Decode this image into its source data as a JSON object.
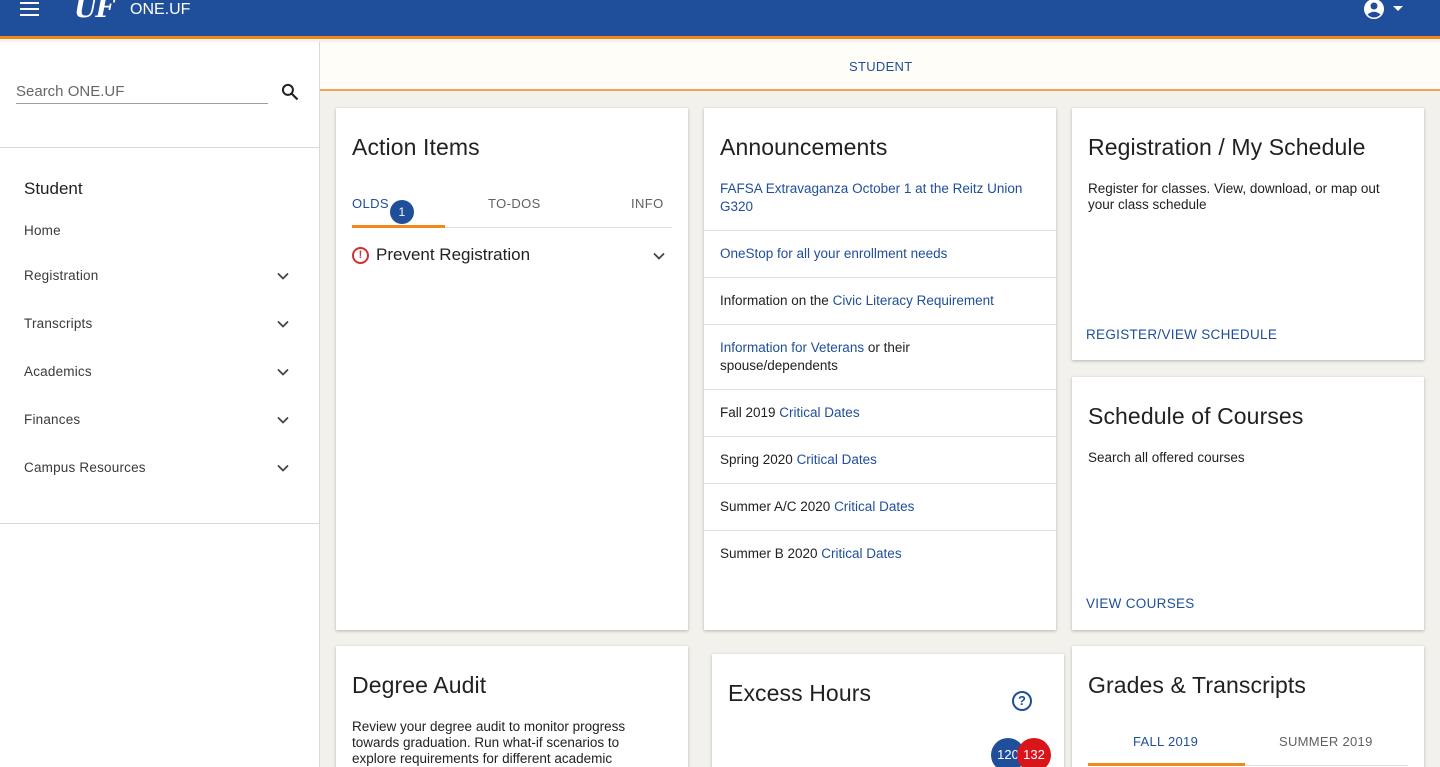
{
  "header": {
    "logo": "UF",
    "title": "ONE.UF"
  },
  "sidebar": {
    "search": {
      "placeholder": "Search ONE.UF",
      "value": ""
    },
    "heading": "Student",
    "items": [
      {
        "label": "Home"
      },
      {
        "label": "Registration"
      },
      {
        "label": "Transcripts"
      },
      {
        "label": "Academics"
      },
      {
        "label": "Finances"
      },
      {
        "label": "Campus Resources"
      }
    ]
  },
  "tabstrip": {
    "active": "STUDENT"
  },
  "action_items": {
    "title": "Action Items",
    "tabs": {
      "holds": "OLDS",
      "holds_count": "1",
      "todos": "TO-DOS",
      "info": "INFO"
    },
    "hold": {
      "label": "Prevent Registration"
    }
  },
  "announcements": {
    "title": "Announcements",
    "items": [
      {
        "prefix": "",
        "link": "FAFSA Extravaganza October 1 at the Reitz Union G320",
        "suffix": ""
      },
      {
        "prefix": "",
        "link": "OneStop for all your enrollment needs",
        "suffix": ""
      },
      {
        "prefix": "Information on the ",
        "link": "Civic Literacy Requirement",
        "suffix": ""
      },
      {
        "prefix": "",
        "link": "Information for Veterans",
        "suffix": " or their spouse/dependents"
      },
      {
        "prefix": "Fall 2019 ",
        "link": "Critical Dates",
        "suffix": ""
      },
      {
        "prefix": "Spring 2020 ",
        "link": "Critical Dates",
        "suffix": ""
      },
      {
        "prefix": "Summer A/C 2020 ",
        "link": "Critical Dates",
        "suffix": ""
      },
      {
        "prefix": "Summer B 2020 ",
        "link": "Critical Dates",
        "suffix": ""
      }
    ]
  },
  "registration": {
    "title": "Registration / My Schedule",
    "text": "Register for classes. View, download, or map out your class schedule",
    "link": "REGISTER/VIEW SCHEDULE"
  },
  "schedule": {
    "title": "Schedule of Courses",
    "text": "Search all offered courses",
    "link": "VIEW COURSES"
  },
  "degree_audit": {
    "title": "Degree Audit",
    "text": "Review your degree audit to monitor progress towards graduation. Run what-if scenarios to explore requirements for different academic"
  },
  "excess_hours": {
    "title": "Excess Hours",
    "help": "?",
    "values": {
      "first": "120",
      "second": "132"
    }
  },
  "grades": {
    "title": "Grades & Transcripts",
    "tabs": [
      "FALL 2019",
      "SUMMER 2019"
    ]
  },
  "colors": {
    "brand_blue": "#1f4e9a",
    "brand_orange": "#f2871e",
    "alert_red": "#d32f2f"
  }
}
